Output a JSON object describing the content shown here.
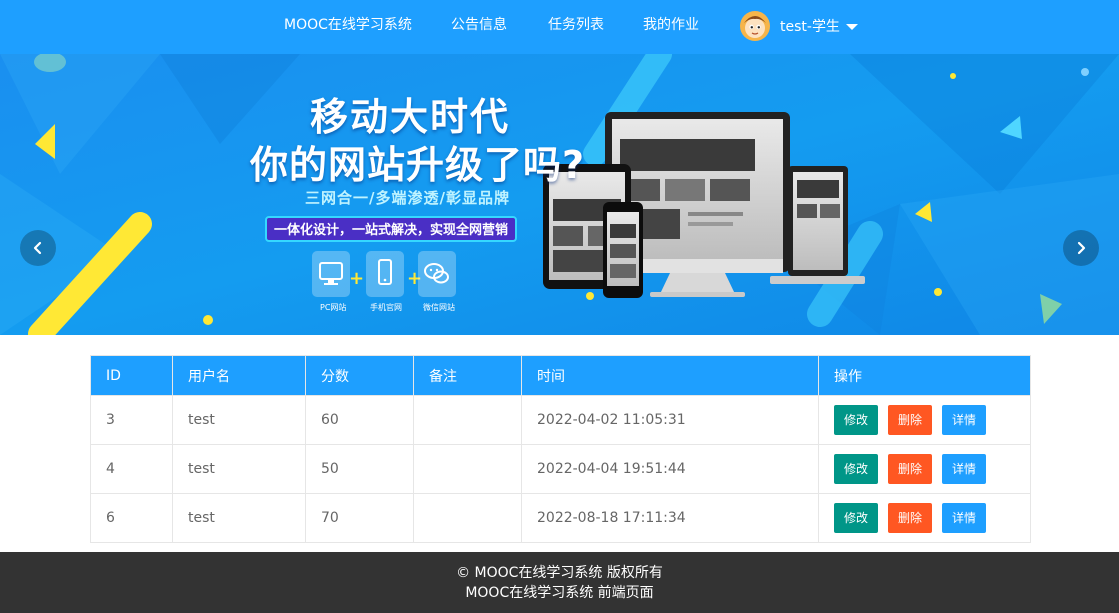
{
  "nav": {
    "items": [
      "MOOC在线学习系统",
      "公告信息",
      "任务列表",
      "我的作业"
    ],
    "user": "test-学生"
  },
  "banner": {
    "headline1": "移动大时代",
    "headline2": "你的网站升级了吗?",
    "subline": "三网合一/多端渗透/彰显品牌",
    "slogan": "一体化设计，一站式解决，实现全网营销",
    "devices": [
      "PC网站",
      "手机官网",
      "微信网站"
    ],
    "slide_count": 3,
    "active_slide": 0,
    "colors": {
      "bg": "#1496ee",
      "accent_yellow": "#ffe835"
    }
  },
  "table": {
    "headers": [
      "ID",
      "用户名",
      "分数",
      "备注",
      "时间",
      "操作"
    ],
    "rows": [
      {
        "id": "3",
        "user": "test",
        "score": "60",
        "note": "",
        "time": "2022-04-02 11:05:31"
      },
      {
        "id": "4",
        "user": "test",
        "score": "50",
        "note": "",
        "time": "2022-04-04 19:51:44"
      },
      {
        "id": "6",
        "user": "test",
        "score": "70",
        "note": "",
        "time": "2022-08-18 17:11:34"
      }
    ],
    "actions": {
      "edit": "修改",
      "delete": "删除",
      "detail": "详情"
    }
  },
  "footer": {
    "line1": "© MOOC在线学习系统 版权所有",
    "line2": "MOOC在线学习系统 前端页面"
  },
  "colors": {
    "primary": "#1e9fff",
    "edit": "#009688",
    "delete": "#ff5722",
    "footer": "#333333"
  }
}
